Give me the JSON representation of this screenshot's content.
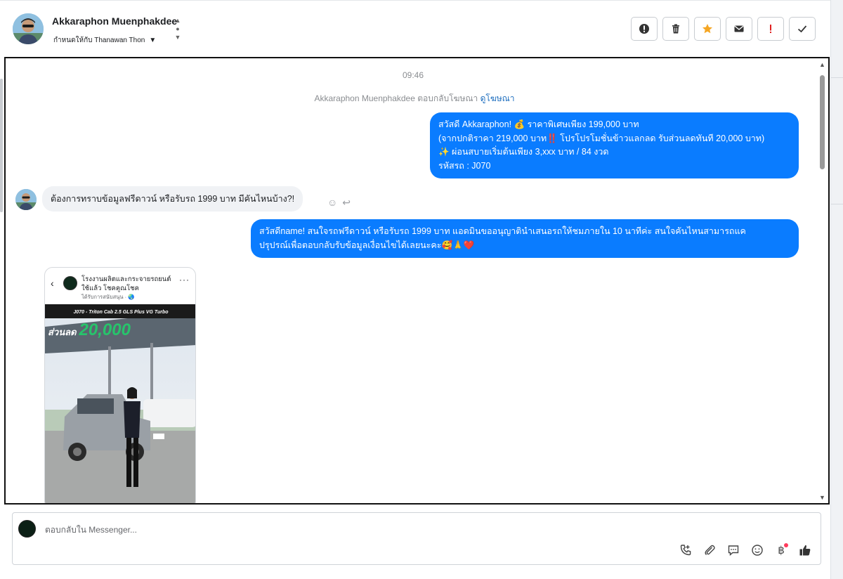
{
  "header": {
    "contact_name": "Akkaraphon Muenphakdee",
    "assigned_label": "กำหนดให้กับ Thanawan Thon",
    "toolbar": [
      {
        "name": "spam-button",
        "icon": "alert-circle-icon",
        "color": "#333333"
      },
      {
        "name": "delete-button",
        "icon": "trash-icon",
        "color": "#333333"
      },
      {
        "name": "star-button",
        "icon": "star-icon",
        "color": "#f5a623"
      },
      {
        "name": "mark-unread-button",
        "icon": "envelope-icon",
        "color": "#333333"
      },
      {
        "name": "important-button",
        "icon": "exclamation-icon",
        "color": "#e02020"
      },
      {
        "name": "done-button",
        "icon": "check-icon",
        "color": "#333333"
      }
    ]
  },
  "conversation": {
    "timestamp": "09:46",
    "ad_reply_note": "Akkaraphon Muenphakdee ตอบกลับโฆษณา",
    "ad_reply_link": "ดูโฆษณา",
    "messages": [
      {
        "direction": "outgoing",
        "lines": [
          "สวัสดี Akkaraphon! 💰 ราคาพิเศษเพียง 199,000 บาท",
          "(จากปกติราคา 219,000 บาท‼️ โปรโปรโมชั่นข้าวแลกลด รับส่วนลดทันที 20,000 บาท)",
          "✨ ผ่อนสบายเริ่มต้นเพียง 3,xxx บาท / 84 งวด",
          "รหัสรถ : J070"
        ]
      },
      {
        "direction": "incoming",
        "text": "ต้องการทราบข้อมูลฟรีดาวน์ หรือรับรถ 1999 บาท มีคันไหนบ้าง?!"
      },
      {
        "direction": "outgoing",
        "lines": [
          "สวัสดีname! สนใจรถฟรีดาวน์ หรือรับรถ 1999 บาท แอดมินขออนุญาตินำเสนอรถให้ชมภายใน 10 นาทีค่ะ สนใจคันไหนสามารถแค",
          "ปรุปรณ์เพื่อตอบกลับรับข้อมูลเงื่อนไขได้เลยนะคะ🥰🙏❤️"
        ]
      }
    ],
    "ad_card": {
      "page_name": "โรงงานผลิตและกระจายรถยนต์ใช้แล้ว โชคคูณโชค",
      "sponsored": "ได้รับการสนับสนุน · 🌏",
      "banner_title": "J070 - Triton Cab 2.5 GLS Plus VG Turbo",
      "discount_label": "ส่วนลด",
      "discount_value": "20,000"
    }
  },
  "composer": {
    "placeholder": "ตอบกลับใน Messenger...",
    "icons": [
      "add-call-icon",
      "paperclip-icon",
      "saved-reply-icon",
      "emoji-icon",
      "baht-icon",
      "thumbs-up-icon"
    ]
  },
  "colors": {
    "outgoing_bubble": "#0a7cff",
    "incoming_bubble": "#f0f2f5",
    "link": "#1f6fbf"
  }
}
